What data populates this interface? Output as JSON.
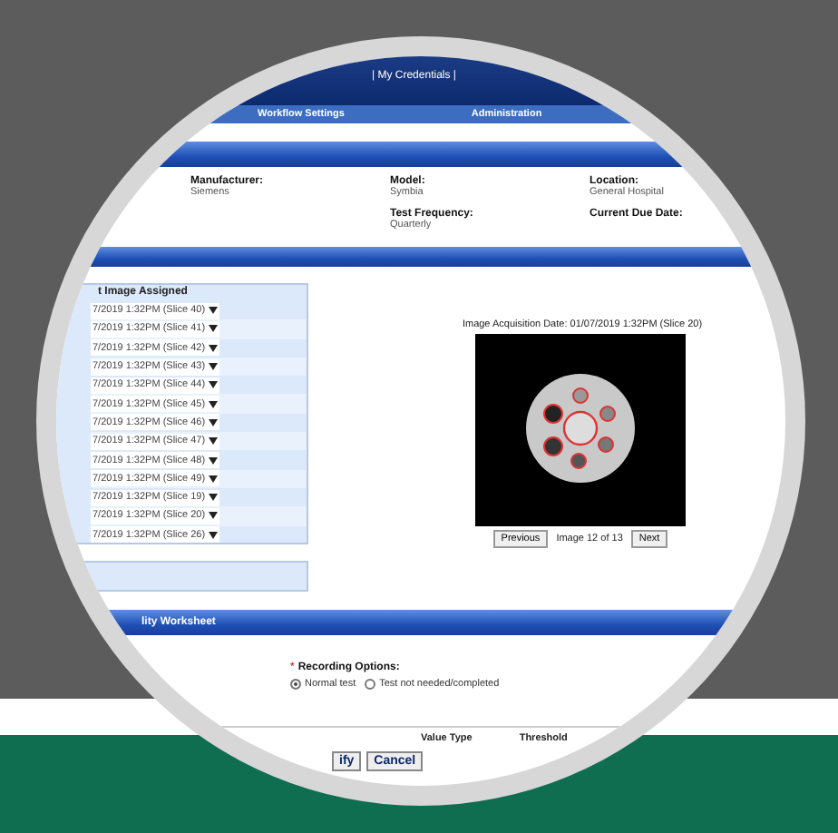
{
  "header": {
    "links": "| My Credentials |"
  },
  "nav": {
    "items": [
      {
        "label": "Workflow Settings"
      },
      {
        "label": "Administration"
      }
    ]
  },
  "info": [
    [
      {
        "label": "Manufacturer:",
        "value": "Siemens"
      },
      {
        "label": "Model:",
        "value": "Symbia"
      },
      {
        "label": "Location:",
        "value": "General Hospital"
      }
    ],
    [
      {
        "label": "Test Frequency:",
        "value": "Quarterly"
      },
      {
        "label": "Current Due Date:"
      }
    ]
  ],
  "slices": {
    "heading": "t Image Assigned",
    "items": [
      "7/2019 1:32PM (Slice 40)",
      "7/2019 1:32PM (Slice 41)",
      "7/2019 1:32PM (Slice 42)",
      "7/2019 1:32PM (Slice 43)",
      "7/2019 1:32PM (Slice 44)",
      "7/2019 1:32PM (Slice 45)",
      "7/2019 1:32PM (Slice 46)",
      "7/2019 1:32PM (Slice 47)",
      "7/2019 1:32PM (Slice 48)",
      "7/2019 1:32PM (Slice 49)",
      "7/2019 1:32PM (Slice 19)",
      "7/2019 1:32PM (Slice 20)",
      "7/2019 1:32PM (Slice 26)"
    ]
  },
  "viewer": {
    "title": "Image Acquisition Date: 01/07/2019 1:32PM (Slice 20)",
    "previous": "Previous",
    "counter": "Image 12 of 13",
    "next": "Next"
  },
  "worksheet": {
    "title": "lity Worksheet",
    "required_mark": "*",
    "options_label": "Recording Options:",
    "options": [
      {
        "label": "Normal test",
        "selected": true
      },
      {
        "label": "Test not needed/completed",
        "selected": false
      }
    ]
  },
  "table": {
    "columns": [
      "Value Type",
      "Threshold"
    ]
  },
  "buttons": [
    "ify",
    "Cancel"
  ]
}
